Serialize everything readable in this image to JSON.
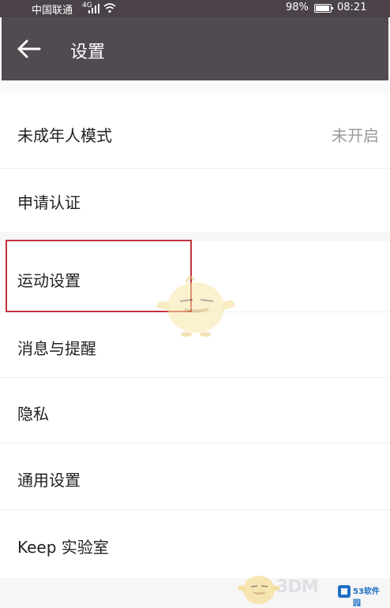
{
  "status_bar": {
    "carrier": "中国联通",
    "network_type": "4G",
    "battery_percent": "98%",
    "time": "08:21"
  },
  "header": {
    "title": "设置",
    "back_icon": "arrow-left-icon"
  },
  "settings": {
    "items": [
      {
        "label": "未成年人模式",
        "value": "未开启"
      },
      {
        "label": "申请认证"
      },
      {
        "label": "运动设置"
      },
      {
        "label": "消息与提醒"
      },
      {
        "label": "隐私"
      },
      {
        "label": "通用设置"
      },
      {
        "label": "Keep 实验室"
      }
    ]
  },
  "watermarks": {
    "site_3dm": "3DM",
    "site_53": "53软件园"
  },
  "colors": {
    "app_bar": "#524a51",
    "status_bar": "#4a4248",
    "highlight_box": "#c4323b",
    "value_text": "#9a9a9a"
  }
}
